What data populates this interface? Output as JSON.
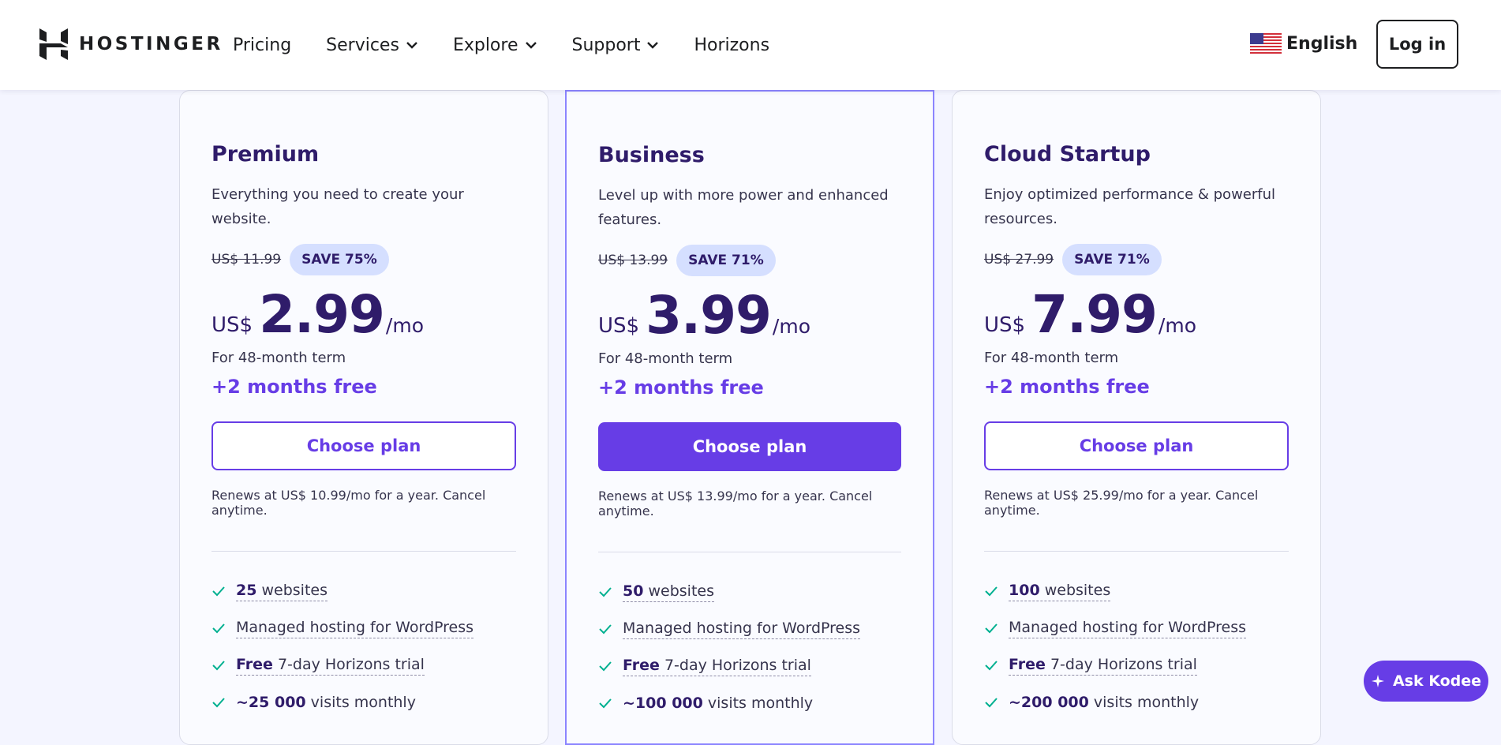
{
  "header": {
    "brand": "HOSTINGER",
    "nav": [
      {
        "label": "Pricing",
        "has_dropdown": false
      },
      {
        "label": "Services",
        "has_dropdown": true
      },
      {
        "label": "Explore",
        "has_dropdown": true
      },
      {
        "label": "Support",
        "has_dropdown": true
      },
      {
        "label": "Horizons",
        "has_dropdown": false
      }
    ],
    "language": "English",
    "language_icon": "us-flag-icon",
    "login_label": "Log in"
  },
  "plans": [
    {
      "name": "Premium",
      "description": "Everything you need to create your website.",
      "old_price": "US$ 11.99",
      "save": "SAVE 75%",
      "currency": "US$",
      "price": "2.99",
      "per": "/mo",
      "term": "For 48-month term",
      "bonus": "+2 months free",
      "cta": "Choose plan",
      "renew": "Renews at US$ 10.99/mo for a year. Cancel anytime.",
      "features": [
        {
          "bold": "25",
          "text": " websites"
        },
        {
          "bold": "",
          "text": "Managed hosting for WordPress"
        },
        {
          "bold": "Free",
          "text": " 7-day Horizons trial"
        },
        {
          "bold": "~25 000",
          "text": " visits monthly"
        }
      ]
    },
    {
      "name": "Business",
      "description": "Level up with more power and enhanced features.",
      "old_price": "US$ 13.99",
      "save": "SAVE 71%",
      "currency": "US$",
      "price": "3.99",
      "per": "/mo",
      "term": "For 48-month term",
      "bonus": "+2 months free",
      "cta": "Choose plan",
      "renew": "Renews at US$ 13.99/mo for a year. Cancel anytime.",
      "features": [
        {
          "bold": "50",
          "text": " websites"
        },
        {
          "bold": "",
          "text": "Managed hosting for WordPress"
        },
        {
          "bold": "Free",
          "text": " 7-day Horizons trial"
        },
        {
          "bold": "~100 000",
          "text": " visits monthly"
        }
      ]
    },
    {
      "name": "Cloud Startup",
      "description": "Enjoy optimized performance & powerful resources.",
      "old_price": "US$ 27.99",
      "save": "SAVE 71%",
      "currency": "US$",
      "price": "7.99",
      "per": "/mo",
      "term": "For 48-month term",
      "bonus": "+2 months free",
      "cta": "Choose plan",
      "renew": "Renews at US$ 25.99/mo for a year. Cancel anytime.",
      "features": [
        {
          "bold": "100",
          "text": " websites"
        },
        {
          "bold": "",
          "text": "Managed hosting for WordPress"
        },
        {
          "bold": "Free",
          "text": " 7-day Horizons trial"
        },
        {
          "bold": "~200 000",
          "text": " visits monthly"
        }
      ]
    }
  ],
  "assistant": {
    "label": "Ask Kodee",
    "icon": "sparkle-icon"
  },
  "colors": {
    "accent": "#673de6",
    "dark": "#2f1c6a",
    "badge": "#d5dfff",
    "check": "#00b090"
  }
}
